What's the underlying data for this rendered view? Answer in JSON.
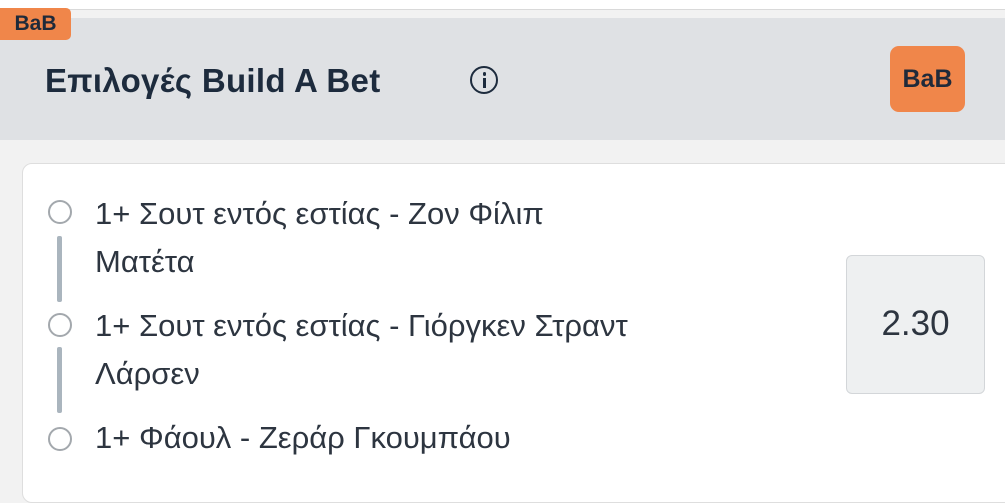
{
  "corner_badge": "BaB",
  "header": {
    "title": "Επιλογές Build A Bet",
    "info_icon": "info-circle-icon",
    "badge_button": "BaB"
  },
  "selections": [
    {
      "line1": "1+ Σουτ εντός εστίας - Ζον Φίλιπ",
      "line2": "Ματέτα"
    },
    {
      "line1": "1+ Σουτ εντός εστίας - Γιόργκεν Στραντ",
      "line2": "Λάρσεν"
    },
    {
      "line1": "1+ Φάουλ - Ζεράρ Γκουμπάου"
    }
  ],
  "odds": "2.30",
  "colors": {
    "accent": "#f0864a",
    "header_bg": "#dfe1e4",
    "text_dark": "#1d2b3d",
    "connector": "#aab5be"
  }
}
